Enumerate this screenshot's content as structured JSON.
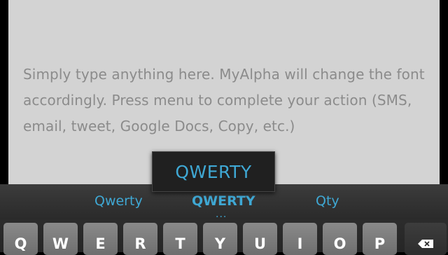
{
  "editor": {
    "hint_text": "Simply type anything here. MyAlpha will change the font accordingly. Press menu to complete your action (SMS, email, tweet, Google Docs, Copy, etc.)"
  },
  "popup": {
    "label": "QWERTY"
  },
  "suggestions": [
    {
      "label": "Qwerty",
      "selected": false
    },
    {
      "label": "QWERTY",
      "selected": true
    },
    {
      "label": "Qty",
      "selected": false
    }
  ],
  "more_indicator": "...",
  "keyboard": {
    "row1": [
      "Q",
      "W",
      "E",
      "R",
      "T",
      "Y",
      "U",
      "I",
      "O",
      "P"
    ],
    "backspace_icon": "backspace-icon"
  },
  "colors": {
    "accent": "#3fa8d4",
    "editor_bg": "#d3d3d3",
    "hint_text": "#8b8b8b",
    "keyboard_bg": "#2a2a2a",
    "key_bg": "#7c7c7c"
  }
}
